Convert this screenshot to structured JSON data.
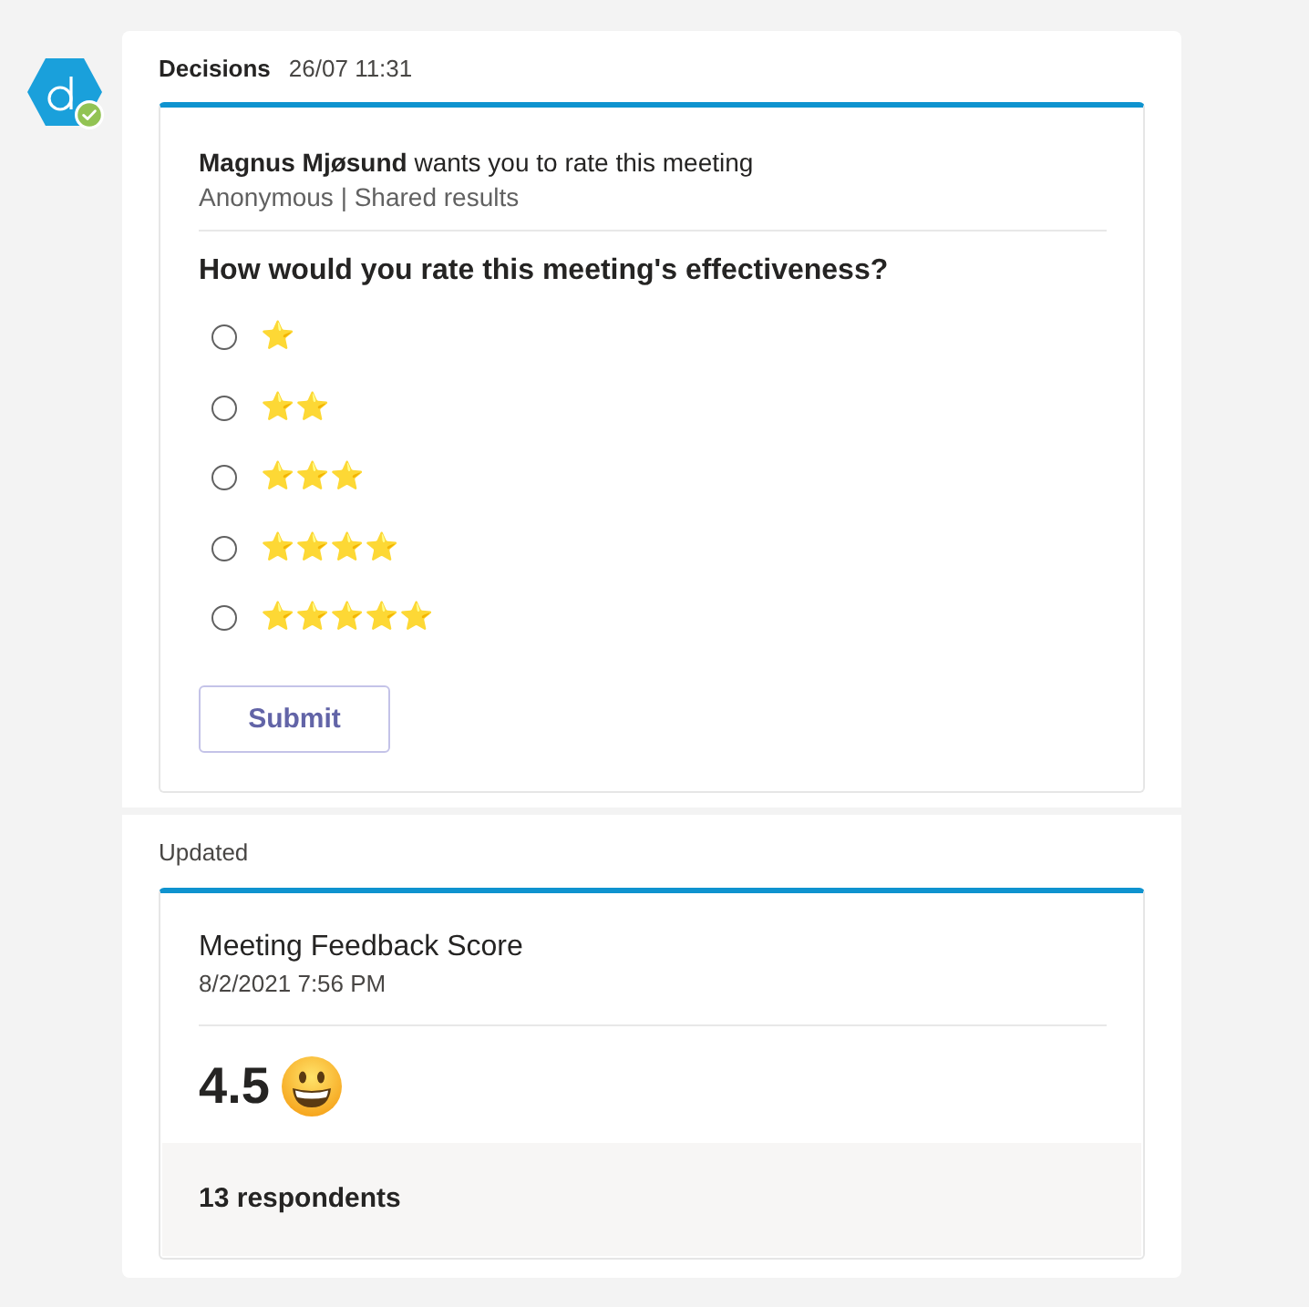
{
  "message": {
    "sender": "Decisions",
    "time": "26/07 11:31"
  },
  "poll": {
    "intro": "**Magnus Mjøsund** wants you to rate this meeting",
    "settings": "Anonymous | Shared results",
    "question": "How would you rate this meeting's effectiveness?",
    "options": [
      {
        "label": "⭐",
        "selected": false
      },
      {
        "label": "⭐⭐",
        "selected": false
      },
      {
        "label": "⭐⭐⭐",
        "selected": false
      },
      {
        "label": "⭐⭐⭐⭐",
        "selected": false
      },
      {
        "label": "⭐⭐⭐⭐⭐",
        "selected": false
      }
    ],
    "submit": "Submit"
  },
  "update": {
    "label": "Updated",
    "title": "Meeting Feedback Score",
    "date": "8/2/2021 7:56 PM",
    "score": "4.5",
    "respondents": "13 respondents"
  }
}
